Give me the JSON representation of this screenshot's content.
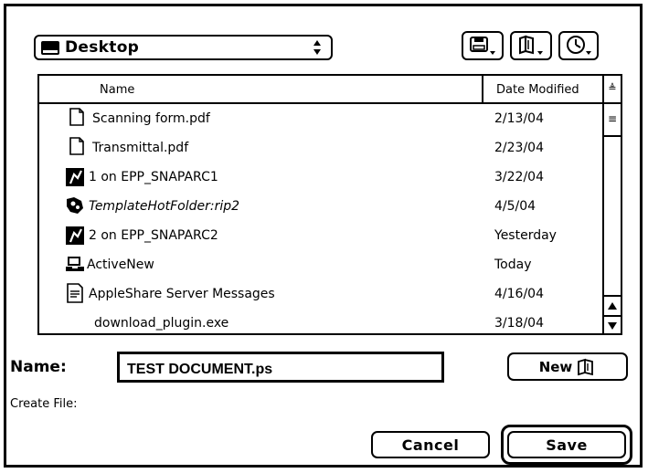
{
  "location": {
    "label": "Desktop",
    "icon": "desktop-icon"
  },
  "toolbar": {
    "buttons": [
      {
        "icon": "disk-icon"
      },
      {
        "icon": "folder-shortcut-icon"
      },
      {
        "icon": "recent-clock-icon"
      }
    ]
  },
  "file_list": {
    "columns": {
      "name": "Name",
      "date": "Date Modified",
      "sort_indicator": "≜"
    },
    "rows": [
      {
        "name": "Scanning form.pdf",
        "date": "2/13/04",
        "icon": "document-icon",
        "italic": false
      },
      {
        "name": "Transmittal.pdf",
        "date": "2/23/04",
        "icon": "document-icon",
        "italic": false
      },
      {
        "name": "1 on EPP_SNAPARC1",
        "date": "3/22/04",
        "icon": "server-volume-icon",
        "italic": false
      },
      {
        "name": "TemplateHotFolder:rip2",
        "date": "4/5/04",
        "icon": "hotfolder-icon",
        "italic": true
      },
      {
        "name": "2 on EPP_SNAPARC2",
        "date": "Yesterday",
        "icon": "server-volume-icon",
        "italic": false
      },
      {
        "name": "ActiveNew",
        "date": "Today",
        "icon": "application-icon",
        "italic": false
      },
      {
        "name": "AppleShare Server Messages",
        "date": "4/16/04",
        "icon": "text-file-icon",
        "italic": false
      },
      {
        "name": "download_plugin.exe",
        "date": "3/18/04",
        "icon": "",
        "italic": false
      }
    ]
  },
  "save_form": {
    "name_label": "Name:",
    "filename": "TEST DOCUMENT.ps",
    "create_label": "Create File:",
    "new_button": "New",
    "cancel_button": "Cancel",
    "save_button": "Save"
  }
}
